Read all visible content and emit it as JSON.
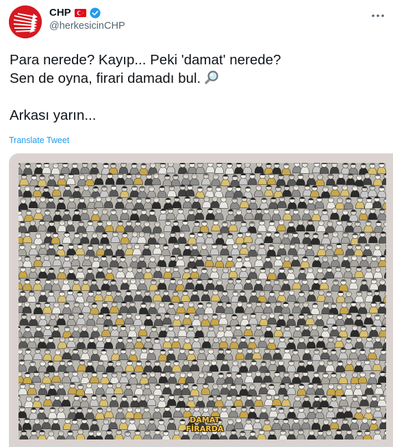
{
  "account": {
    "display_name": "CHP",
    "handle": "@herkesicinCHP",
    "brand_color": "#d71921",
    "flag_color": "#e30a17",
    "verified_color": "#1d9bf0"
  },
  "icons": {
    "avatar": "chp-six-arrows-logo",
    "flag": "turkey-flag-icon",
    "verified": "verified-badge-icon",
    "more": "more-icon",
    "magnifier": "magnifying-glass-icon"
  },
  "tweet": {
    "line1": "Para nerede? Kayıp... Peki 'damat' nerede?",
    "line2": "Sen de oyna, firari damadı bul.",
    "line3": "Arkası yarın...",
    "translate_label": "Translate Tweet"
  },
  "media": {
    "stamp_line1": "DAMAT",
    "stamp_line2": "FİRARDA"
  }
}
